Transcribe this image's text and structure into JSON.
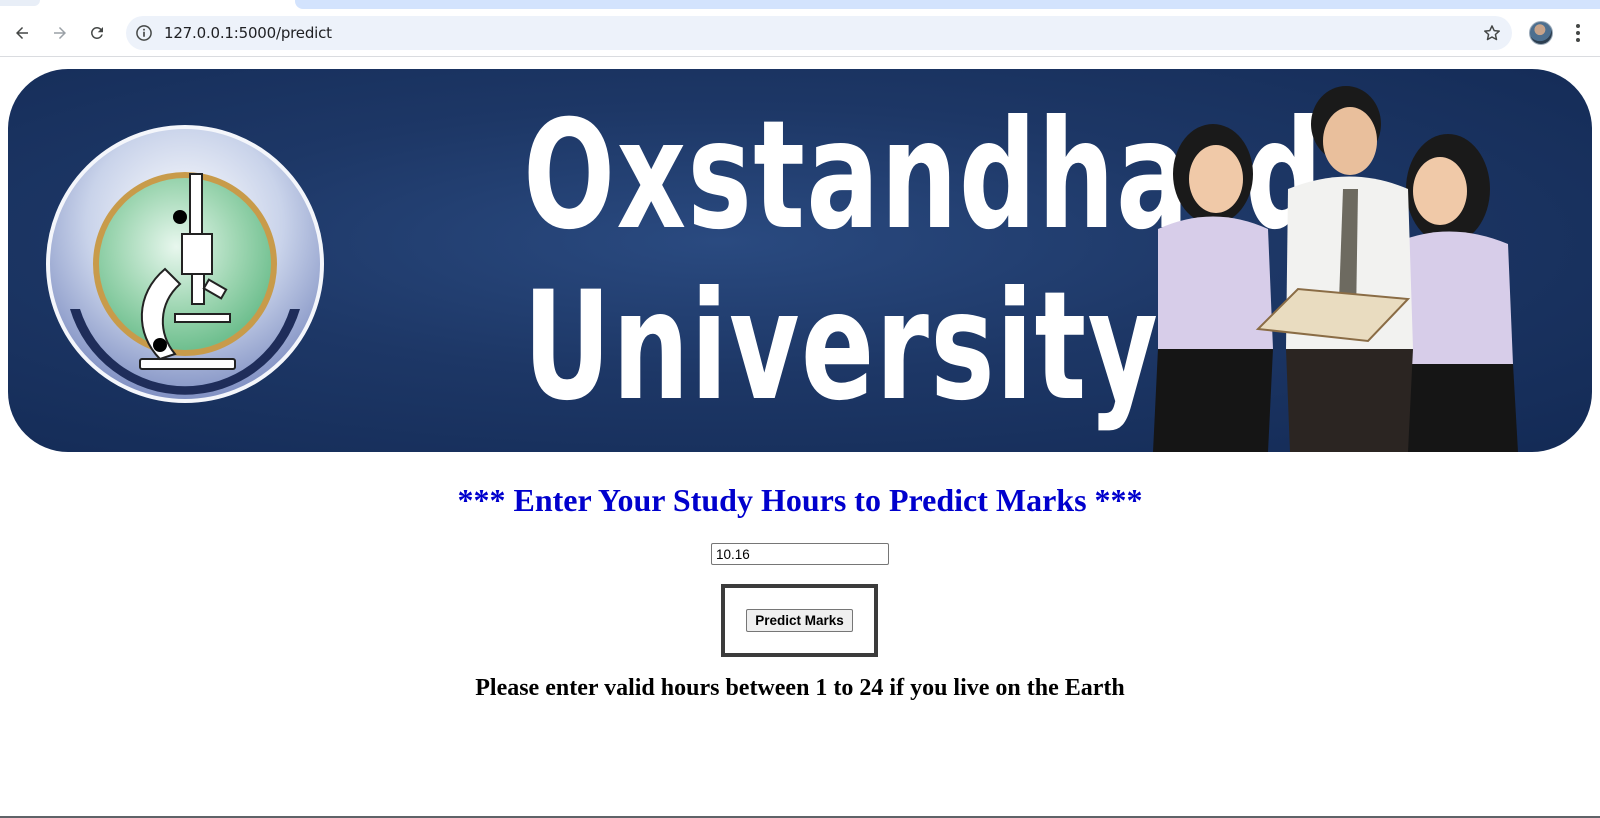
{
  "browser": {
    "url": "127.0.0.1:5000/predict",
    "icons": [
      "back-icon",
      "forward-icon",
      "reload-icon",
      "site-info-icon",
      "bookmark-star-icon",
      "profile-avatar",
      "more-menu-icon"
    ]
  },
  "banner": {
    "title_line1": "Oxstandhard",
    "title_line2": "University",
    "colors": {
      "background": "#1d3766",
      "title": "#ffffff"
    }
  },
  "form": {
    "heading": "*** Enter Your Study Hours to Predict Marks ***",
    "heading_color": "#0000cd",
    "hours_value": "10.16",
    "submit_label": "Predict Marks"
  },
  "result": {
    "message": "Please enter valid hours between 1 to 24 if you live on the Earth"
  }
}
